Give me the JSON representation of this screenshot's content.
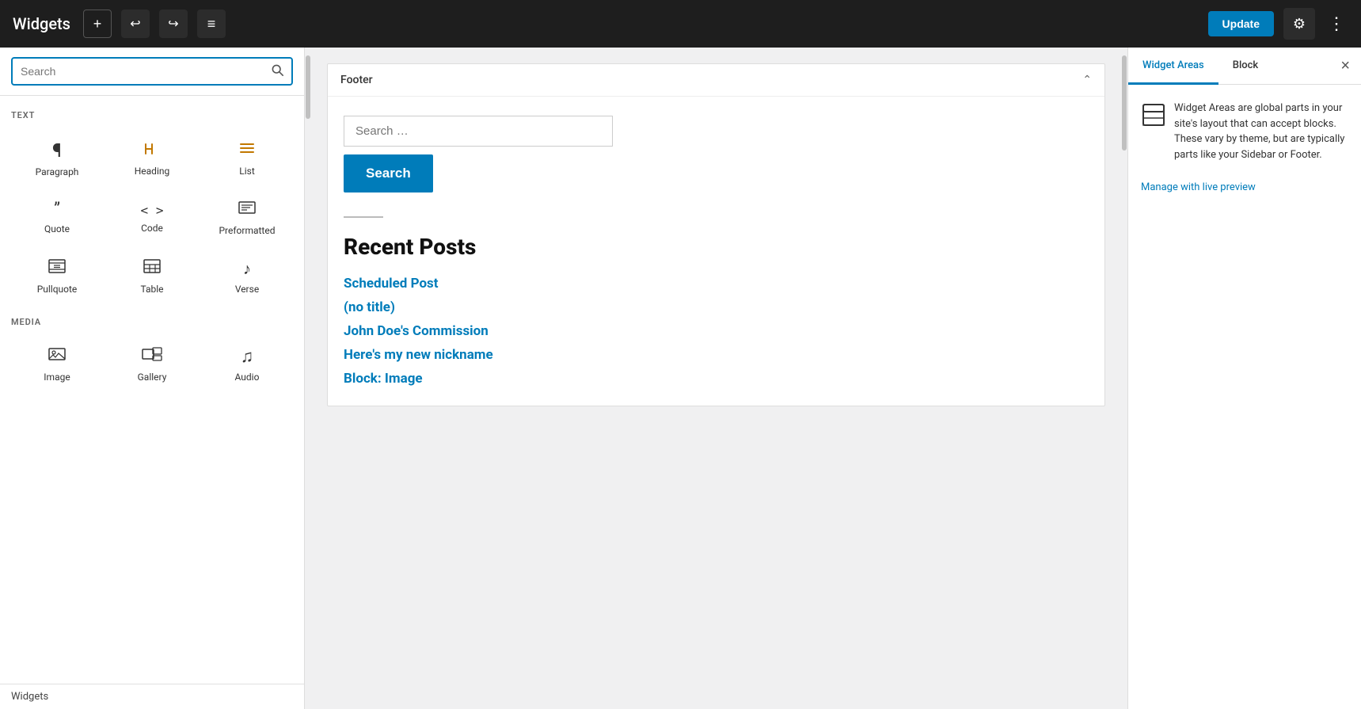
{
  "topbar": {
    "title": "Widgets",
    "add_label": "+",
    "undo_label": "↩",
    "redo_label": "↪",
    "list_label": "≡",
    "update_label": "Update",
    "settings_label": "⚙",
    "more_label": "⋮"
  },
  "left_panel": {
    "search_placeholder": "Search",
    "text_section_label": "TEXT",
    "text_blocks": [
      {
        "icon": "¶",
        "label": "Paragraph",
        "color": "normal"
      },
      {
        "icon": "🔖",
        "label": "Heading",
        "color": "orange"
      },
      {
        "icon": "≡",
        "label": "List",
        "color": "orange"
      },
      {
        "icon": "❝",
        "label": "Quote",
        "color": "normal"
      },
      {
        "icon": "<>",
        "label": "Code",
        "color": "normal"
      },
      {
        "icon": "⊞",
        "label": "Preformatted",
        "color": "normal"
      },
      {
        "icon": "⊟",
        "label": "Pullquote",
        "color": "normal"
      },
      {
        "icon": "⊞",
        "label": "Table",
        "color": "normal"
      },
      {
        "icon": "♪",
        "label": "Verse",
        "color": "normal"
      }
    ],
    "media_section_label": "MEDIA",
    "media_blocks": [
      {
        "icon": "🖼",
        "label": "Image",
        "color": "normal"
      },
      {
        "icon": "⊟",
        "label": "Gallery",
        "color": "normal"
      },
      {
        "icon": "♫",
        "label": "Audio",
        "color": "normal"
      }
    ],
    "footer_label": "Widgets"
  },
  "center_panel": {
    "footer_section_title": "Footer",
    "search_placeholder": "Search …",
    "search_button_label": "Search",
    "recent_posts_title": "Recent Posts",
    "recent_posts": [
      {
        "title": "Scheduled Post"
      },
      {
        "title": "(no title)"
      },
      {
        "title": "John Doe's Commission"
      },
      {
        "title": "Here's my new nickname"
      },
      {
        "title": "Block: Image"
      }
    ]
  },
  "right_panel": {
    "tab_widget_areas": "Widget Areas",
    "tab_block": "Block",
    "close_label": "×",
    "description": "Widget Areas are global parts in your site's layout that can accept blocks. These vary by theme, but are typically parts like your Sidebar or Footer.",
    "manage_label": "Manage with live preview"
  }
}
